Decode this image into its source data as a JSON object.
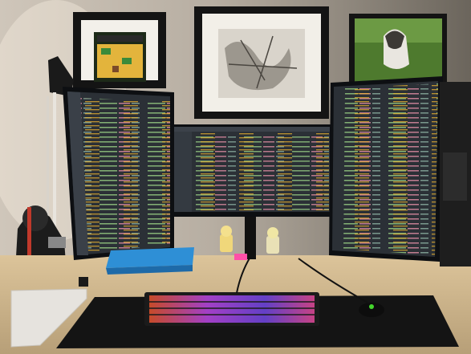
{
  "colors": {
    "wall_left": "#cfc6ba",
    "wall_right": "#6b655c",
    "desk": "#cdb58c",
    "code_bg": "#2b3036",
    "keyboard_glow": "#d04cff"
  }
}
